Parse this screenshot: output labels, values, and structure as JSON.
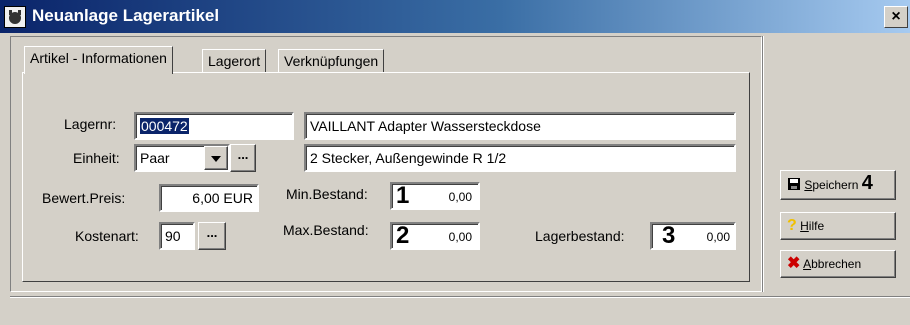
{
  "window": {
    "title": "Neuanlage Lagerartikel",
    "close_label": "×"
  },
  "tabs": [
    "Artikel - Informationen",
    "Lagerort",
    "Verknüpfungen"
  ],
  "form": {
    "lagernr": {
      "label": "Lagernr:",
      "value": "000472"
    },
    "description": "VAILLANT Adapter Wassersteckdose",
    "einheit": {
      "label": "Einheit:",
      "value": "Paar",
      "more": "..."
    },
    "detail": "2 Stecker, Außengewinde R 1/2",
    "preis": {
      "label": "Bewert.Preis:",
      "value": "6,00 EUR"
    },
    "kostenart": {
      "label": "Kostenart:",
      "value": "90",
      "more": "..."
    },
    "min_bestand": {
      "label": "Min.Bestand:",
      "marker": "1",
      "value": "0,00"
    },
    "max_bestand": {
      "label": "Max.Bestand:",
      "marker": "2",
      "value": "0,00"
    },
    "lagerbestand": {
      "label": "Lagerbestand:",
      "marker": "3",
      "value": "0,00"
    }
  },
  "buttons": {
    "save": {
      "first": "S",
      "rest": "peichern",
      "marker": "4"
    },
    "help": {
      "first": "H",
      "rest": "ilfe"
    },
    "cancel": {
      "first": "A",
      "rest": "bbrechen"
    }
  },
  "colors": {
    "titlebar_start": "#0a246a",
    "titlebar_end": "#a6caf0",
    "selection": "#0a246a",
    "cancel_icon": "#cc0000",
    "help_icon": "#f0c000"
  }
}
